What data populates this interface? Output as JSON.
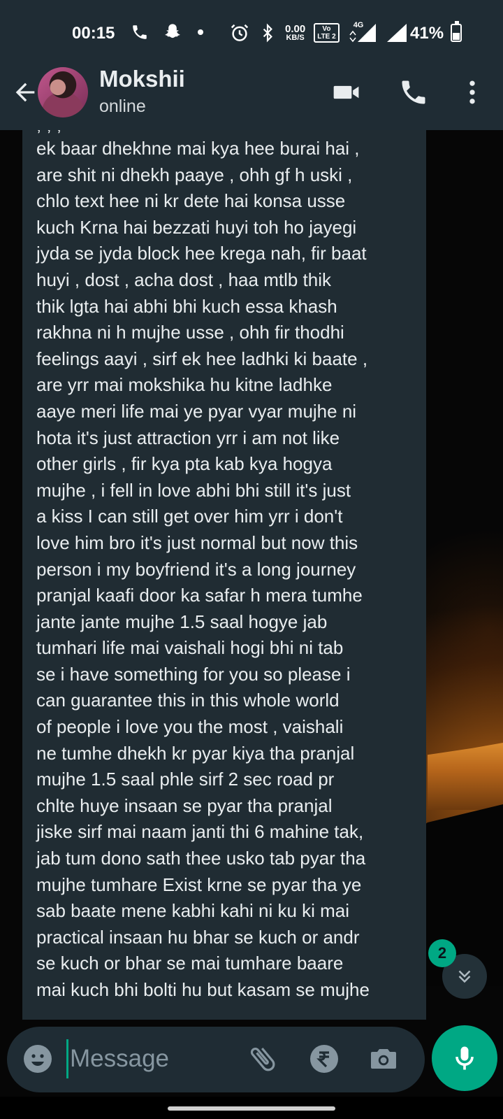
{
  "status_bar": {
    "time": "00:15",
    "net_speed_value": "0.00",
    "net_speed_unit": "KB/S",
    "volte_label": "Vo",
    "lte_label": "LTE 2",
    "network_type": "4G",
    "battery": "41%",
    "icons": [
      "phone-icon",
      "snapchat-icon",
      "dot-icon",
      "alarm-icon",
      "bluetooth-icon",
      "signal-icon",
      "battery-icon"
    ]
  },
  "header": {
    "contact_name": "Mokshii",
    "contact_status": "online",
    "icons": [
      "back-arrow-icon",
      "video-call-icon",
      "voice-call-icon",
      "more-options-icon"
    ]
  },
  "message": {
    "top_fragment": "                  ,               ,                  ,",
    "lines": [
      "ek baar dhekhne mai kya hee burai hai ,",
      "are shit ni dhekh paaye , ohh gf h uski ,",
      "chlo text hee ni kr dete hai konsa usse",
      "kuch Krna hai bezzati huyi toh ho jayegi",
      "jyda se jyda block hee krega nah, fir baat",
      "huyi , dost , acha dost , haa mtlb thik",
      "thik lgta hai abhi bhi kuch essa khash",
      "rakhna ni h mujhe usse , ohh fir thodhi",
      "feelings aayi , sirf ek hee ladhki ki baate ,",
      "are yrr mai mokshika hu kitne ladhke",
      "aaye meri life mai ye pyar vyar mujhe ni",
      "hota it's just attraction yrr i am not like",
      "other girls , fir kya pta kab kya hogya",
      "mujhe , i fell in love abhi bhi still it's just",
      "a kiss I can still get over him yrr i don't",
      "love him bro it's just normal but now this",
      "person i my boyfriend it's a long journey",
      "pranjal kaafi door ka safar h mera tumhe",
      "jante jante mujhe 1.5 saal hogye jab",
      "tumhari life mai vaishali hogi bhi ni tab",
      "se i have something for you so please i",
      "can guarantee this in this whole world",
      "of people i love you the most , vaishali",
      "ne tumhe dhekh kr pyar kiya tha pranjal",
      "mujhe 1.5 saal phle sirf 2 sec road pr",
      "chlte huye insaan se pyar tha pranjal",
      "jiske sirf mai naam janti thi 6 mahine tak,",
      "jab tum dono sath thee usko tab pyar tha",
      "mujhe tumhare Exist krne se pyar tha ye",
      "sab baate mene kabhi kahi ni ku ki mai",
      "practical insaan hu bhar se kuch or andr",
      "se kuch or bhar se mai tumhare baare",
      "mai kuch bhi bolti hu but kasam se mujhe",
      "                                            "
    ]
  },
  "scroll": {
    "unread_count": "2",
    "icon": "double-chevron-down-icon"
  },
  "input_bar": {
    "placeholder": "Message",
    "icons": [
      "emoji-icon",
      "attach-icon",
      "rupee-payment-icon",
      "camera-icon",
      "mic-icon"
    ]
  },
  "colors": {
    "header_bg": "#1f2c34",
    "bubble_bg": "#202c33",
    "accent": "#00a884",
    "text_primary": "#e9edef",
    "text_secondary": "#8696a0"
  }
}
